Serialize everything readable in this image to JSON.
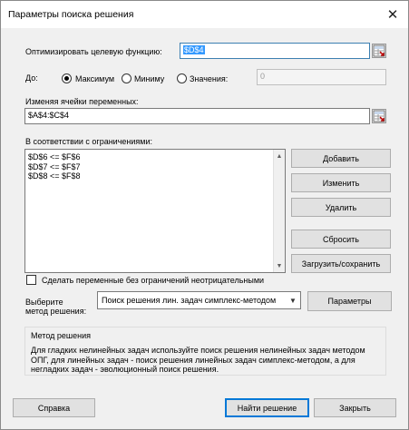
{
  "window": {
    "title": "Параметры поиска решения"
  },
  "objective": {
    "label": "Оптимизировать целевую функцию:",
    "value": "$D$4"
  },
  "to": {
    "label": "До:",
    "options": [
      {
        "label": "Максимум",
        "selected": true
      },
      {
        "label": "Миниму",
        "selected": false
      },
      {
        "label": "Значения:",
        "selected": false
      }
    ],
    "value": "0"
  },
  "variables": {
    "label": "Изменяя ячейки переменных:",
    "value": "$A$4:$C$4"
  },
  "constraints": {
    "label": "В соответствии с ограничениями:",
    "items": [
      "$D$6 <= $F$6",
      "$D$7 <= $F$7",
      "$D$8 <= $F$8"
    ]
  },
  "buttons": {
    "add": "Добавить",
    "change": "Изменить",
    "delete": "Удалить",
    "reset": "Сбросить",
    "load_save": "Загрузить/сохранить",
    "options": "Параметры",
    "help": "Справка",
    "solve": "Найти решение",
    "close": "Закрыть"
  },
  "nonnegative": {
    "label": "Сделать переменные без ограничений неотрицательными",
    "checked": false
  },
  "method": {
    "label_line1": "Выберите",
    "label_line2": "метод решения:",
    "selected": "Поиск решения лин. задач симплекс-методом"
  },
  "method_group": {
    "title": "Метод решения",
    "description": "Для гладких нелинейных задач используйте поиск решения нелинейных задач методом ОПГ, для линейных задач - поиск решения линейных задач симплекс-методом, а для негладких задач - эволюционный поиск решения."
  },
  "icons": {
    "close": "close-icon",
    "range": "range-selector-icon"
  }
}
